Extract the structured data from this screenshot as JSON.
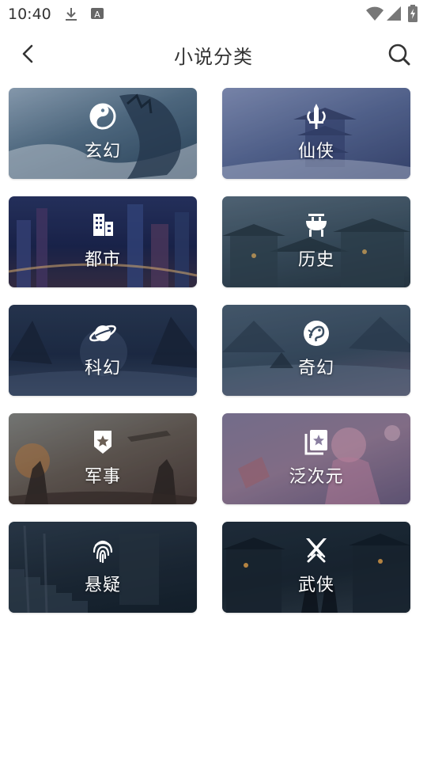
{
  "status_bar": {
    "time": "10:40",
    "icons": [
      "download-icon",
      "a-box-icon",
      "wifi-icon",
      "signal-icon",
      "battery-icon"
    ]
  },
  "header": {
    "back_icon": "chevron-left-icon",
    "title": "小说分类",
    "search_icon": "search-icon"
  },
  "categories": [
    {
      "label": "玄幻",
      "icon": "taiji-icon"
    },
    {
      "label": "仙侠",
      "icon": "sword-icon"
    },
    {
      "label": "都市",
      "icon": "buildings-icon"
    },
    {
      "label": "历史",
      "icon": "bronze-ding-icon"
    },
    {
      "label": "科幻",
      "icon": "planet-icon"
    },
    {
      "label": "奇幻",
      "icon": "dragon-icon"
    },
    {
      "label": "军事",
      "icon": "military-badge-icon"
    },
    {
      "label": "泛次元",
      "icon": "album-star-icon"
    },
    {
      "label": "悬疑",
      "icon": "fingerprint-icon"
    },
    {
      "label": "武侠",
      "icon": "crossed-swords-icon"
    }
  ],
  "colors": {
    "title_text": "#333333",
    "card_label_text": "#ffffff",
    "page_background": "#ffffff"
  }
}
